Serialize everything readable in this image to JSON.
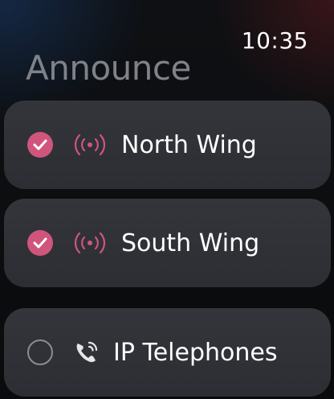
{
  "status_bar": {
    "time": "10:35"
  },
  "header": {
    "title": "Announce"
  },
  "items": [
    {
      "label": "North Wing",
      "selected": true,
      "icon": "broadcast-icon"
    },
    {
      "label": "South Wing",
      "selected": true,
      "icon": "broadcast-icon"
    },
    {
      "label": "IP Telephones",
      "selected": false,
      "icon": "phone-wifi-icon"
    }
  ],
  "colors": {
    "accent": "#d0557d",
    "card": "#303237",
    "title": "#7f8288"
  }
}
